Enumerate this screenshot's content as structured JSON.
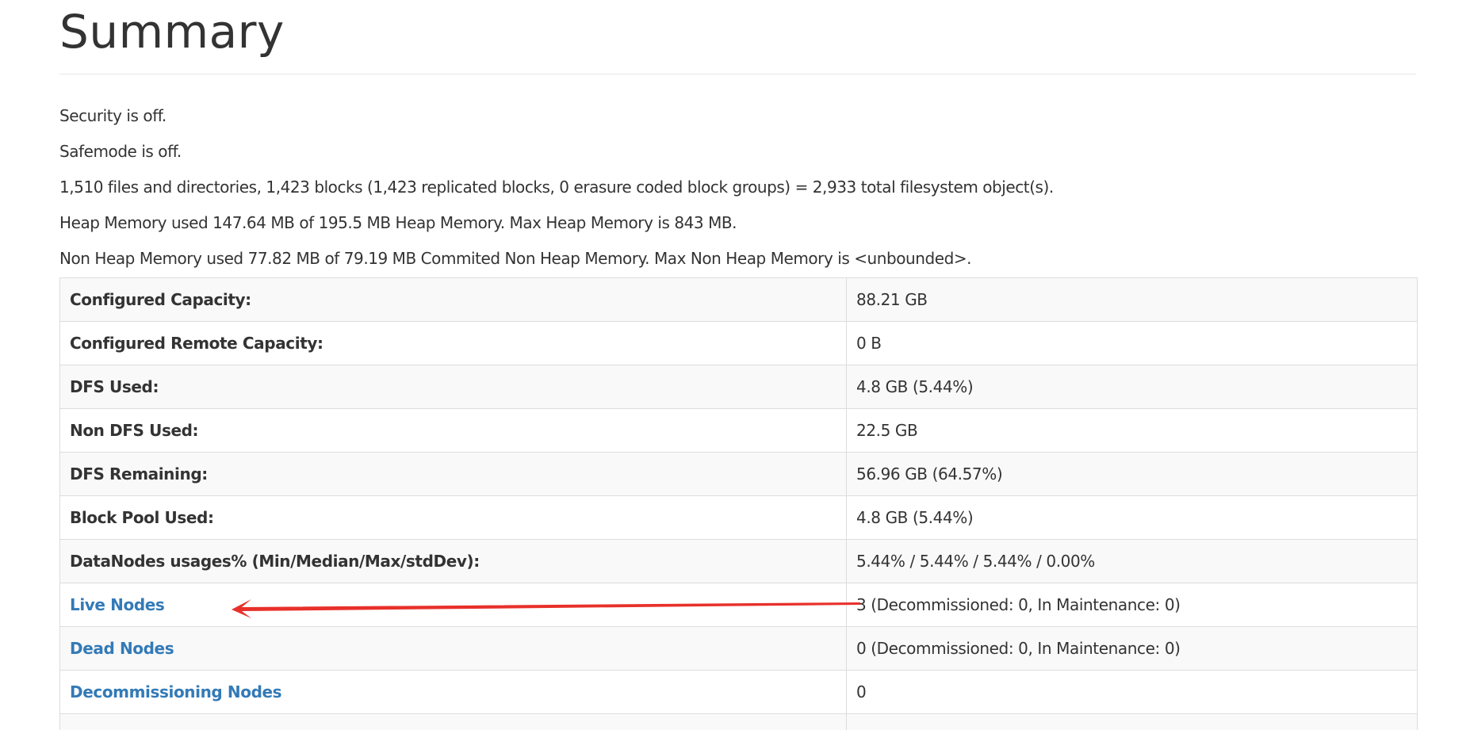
{
  "page": {
    "title": "Summary"
  },
  "summary": {
    "lines": [
      "Security is off.",
      "Safemode is off.",
      "1,510 files and directories, 1,423 blocks (1,423 replicated blocks, 0 erasure coded block groups) = 2,933 total filesystem object(s).",
      "Heap Memory used 147.64 MB of 195.5 MB Heap Memory. Max Heap Memory is 843 MB.",
      "Non Heap Memory used 77.82 MB of 79.19 MB Commited Non Heap Memory. Max Non Heap Memory is <unbounded>."
    ]
  },
  "table": {
    "rows": [
      {
        "label": "Configured Capacity:",
        "value": "88.21 GB",
        "is_link": false
      },
      {
        "label": "Configured Remote Capacity:",
        "value": "0 B",
        "is_link": false
      },
      {
        "label": "DFS Used:",
        "value": "4.8 GB (5.44%)",
        "is_link": false
      },
      {
        "label": "Non DFS Used:",
        "value": "22.5 GB",
        "is_link": false
      },
      {
        "label": "DFS Remaining:",
        "value": "56.96 GB (64.57%)",
        "is_link": false
      },
      {
        "label": "Block Pool Used:",
        "value": "4.8 GB (5.44%)",
        "is_link": false
      },
      {
        "label": "DataNodes usages% (Min/Median/Max/stdDev):",
        "value": "5.44% / 5.44% / 5.44% / 0.00%",
        "is_link": false
      },
      {
        "label": "Live Nodes",
        "value": "3 (Decommissioned: 0, In Maintenance: 0)",
        "is_link": true
      },
      {
        "label": "Dead Nodes",
        "value": "0 (Decommissioned: 0, In Maintenance: 0)",
        "is_link": true
      },
      {
        "label": "Decommissioning Nodes",
        "value": "0",
        "is_link": true
      },
      {
        "label": "",
        "value": "",
        "is_link": false
      }
    ]
  },
  "colors": {
    "link": "#337ab7",
    "text": "#333333",
    "border": "#dddddd",
    "stripe": "#f9f9f9",
    "annotation": "#e8302a"
  }
}
